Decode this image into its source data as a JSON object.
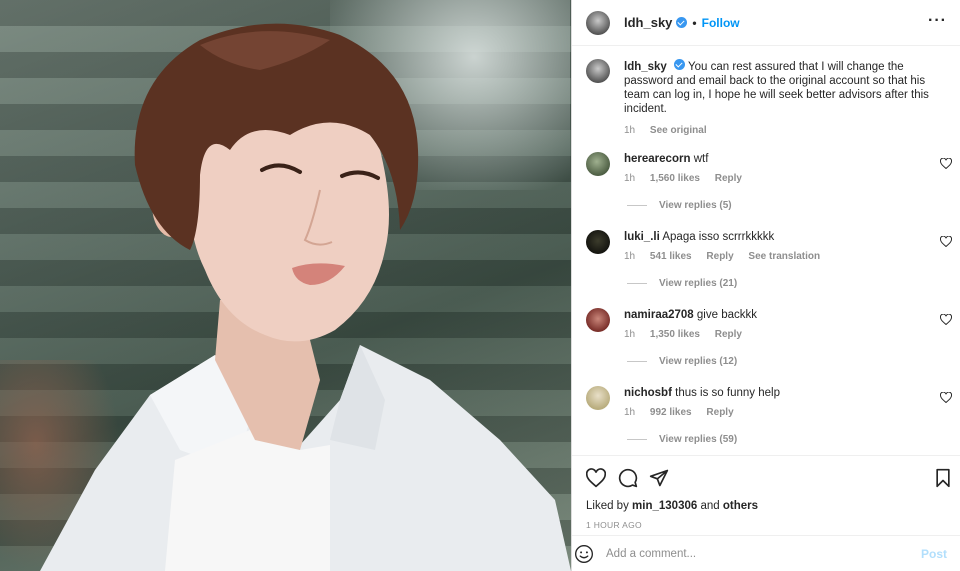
{
  "post": {
    "username": "ldh_sky",
    "follow_label": "Follow",
    "separator": "•",
    "more_label": "···"
  },
  "caption": {
    "username": "ldh_sky",
    "text": "You can rest assured that I will change the password and email back to the original account so that his team can log in, I hope he will seek better advisors after this incident.",
    "time": "1h",
    "see_original": "See original"
  },
  "comments": [
    {
      "username": "herearecorn",
      "text": "wtf",
      "time": "1h",
      "likes": "1,560 likes",
      "reply": "Reply",
      "view_replies": "View replies (5)"
    },
    {
      "username": "luki_.li",
      "text": "Apaga isso scrrrkkkkk",
      "time": "1h",
      "likes": "541 likes",
      "reply": "Reply",
      "see_translation": "See translation",
      "view_replies": "View replies (21)"
    },
    {
      "username": "namiraa2708",
      "text": "give backkk",
      "time": "1h",
      "likes": "1,350 likes",
      "reply": "Reply",
      "view_replies": "View replies (12)"
    },
    {
      "username": "nichosbf",
      "text": "thus is so funny help",
      "time": "1h",
      "likes": "992 likes",
      "reply": "Reply",
      "view_replies": "View replies (59)"
    }
  ],
  "actions": {
    "icons": [
      "heart-icon",
      "comment-icon",
      "share-icon",
      "bookmark-icon"
    ]
  },
  "likes": {
    "prefix": "Liked by",
    "user": "min_130306",
    "and": "and",
    "others": "others"
  },
  "timestamp": "1 HOUR AGO",
  "add_comment": {
    "placeholder": "Add a comment...",
    "post_label": "Post"
  },
  "colors": {
    "accent": "#0095f6",
    "post_disabled": "#b2dffc",
    "muted": "#8e8e8e",
    "verified": "#3897f0"
  }
}
